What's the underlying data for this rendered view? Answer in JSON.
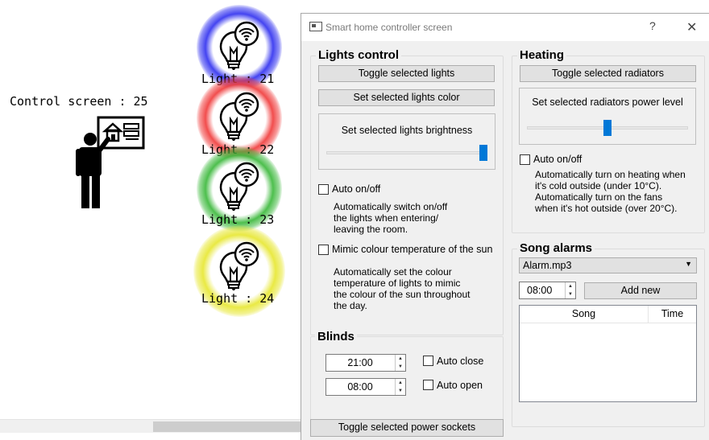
{
  "scene": {
    "control_screen_label": "Control screen : 25",
    "lights": [
      {
        "label": "Light : 21",
        "glow_color": "#3a3af0"
      },
      {
        "label": "Light : 22",
        "glow_color": "#f03a3a"
      },
      {
        "label": "Light : 23",
        "glow_color": "#3ab83a"
      },
      {
        "label": "Light : 24",
        "glow_color": "#e8e83a"
      }
    ]
  },
  "window": {
    "title": "Smart home controller screen",
    "help_glyph": "?",
    "close_glyph": "✕"
  },
  "lights_control": {
    "title": "Lights control",
    "toggle_button": "Toggle selected lights",
    "color_button": "Set selected lights color",
    "brightness_label": "Set selected lights brightness",
    "brightness_level": 1.0,
    "auto_label": "Auto on/off",
    "auto_checked": false,
    "auto_desc": "Automatically switch on/off the lights when entering/ leaving the room.",
    "mimic_label": "Mimic colour temperature of the sun",
    "mimic_checked": false,
    "mimic_desc": "Automatically set the colour temperature of lights to mimic the colour of the sun throughout the day."
  },
  "heating": {
    "title": "Heating",
    "toggle_button": "Toggle selected radiators",
    "power_label": "Set selected radiators power level",
    "power_level": 0.5,
    "auto_label": "Auto on/off",
    "auto_checked": false,
    "auto_desc": "Automatically turn on heating when it's cold outside (under 10°C). Automatically turn on the fans when it's hot outside (over 20°C)."
  },
  "blinds": {
    "title": "Blinds",
    "close_time": "21:00",
    "open_time": "08:00",
    "auto_close_label": "Auto close",
    "auto_open_label": "Auto open"
  },
  "song_alarms": {
    "title": "Song alarms",
    "selected_song": "Alarm.mp3",
    "time": "08:00",
    "add_button": "Add new",
    "columns": [
      "Song",
      "Time"
    ]
  },
  "power_button": "Toggle selected power sockets",
  "colors": {
    "accent": "#0078d7",
    "window_bg": "#f0f0f0"
  }
}
